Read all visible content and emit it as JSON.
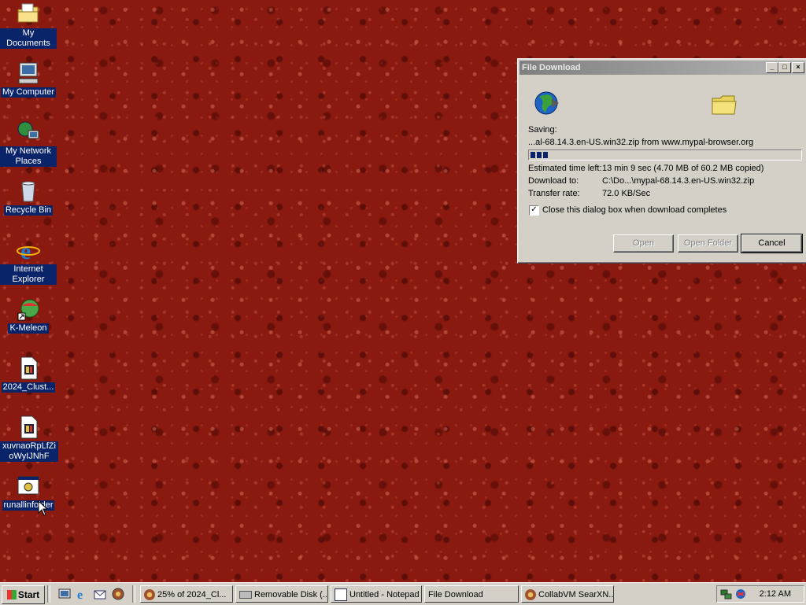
{
  "desktop": {
    "icons": [
      {
        "label": "My Documents",
        "icon": "my-documents-icon"
      },
      {
        "label": "My Computer",
        "icon": "my-computer-icon"
      },
      {
        "label": "My Network Places",
        "icon": "network-places-icon"
      },
      {
        "label": "Recycle Bin",
        "icon": "recycle-bin-icon"
      },
      {
        "label": "Internet Explorer",
        "icon": "internet-explorer-icon"
      },
      {
        "label": "K-Meleon",
        "icon": "k-meleon-icon"
      },
      {
        "label": "2024_Clust...",
        "icon": "file-icon"
      },
      {
        "label": "xuvnaoRpLfZioWyIJNhF",
        "icon": "file-icon"
      },
      {
        "label": "runallinfolder",
        "icon": "program-icon"
      }
    ]
  },
  "dialog": {
    "title": "File Download",
    "saving_label": "Saving:",
    "filename": "...al-68.14.3.en-US.win32.zip from www.mypal-browser.org",
    "progress_fraction": 0.08,
    "time_left_label": "Estimated time left:",
    "time_left_value": "13 min 9 sec (4.70 MB of 60.2 MB copied)",
    "download_to_label": "Download to:",
    "download_to_value": "C:\\Do...\\mypal-68.14.3.en-US.win32.zip",
    "rate_label": "Transfer rate:",
    "rate_value": "72.0 KB/Sec",
    "close_checkbox_label": "Close this dialog box when download completes",
    "close_checkbox_checked": true,
    "buttons": {
      "open": "Open",
      "open_folder": "Open Folder",
      "cancel": "Cancel"
    },
    "title_buttons": {
      "minimize": "_",
      "maximize": "□",
      "close": "×"
    }
  },
  "taskbar": {
    "start_label": "Start",
    "tasks": [
      {
        "label": "25% of 2024_Cl...",
        "icon": "k-meleon-icon"
      },
      {
        "label": "Removable Disk (...",
        "icon": "drive-icon"
      },
      {
        "label": "Untitled - Notepad",
        "icon": "notepad-icon"
      },
      {
        "label": "File Download",
        "icon": ""
      },
      {
        "label": "CollabVM SearXN...",
        "icon": "k-meleon-icon"
      }
    ],
    "clock": "2:12 AM"
  },
  "colors": {
    "selection": "#0a246a",
    "desktop": "#8a1a10",
    "face": "#d4d0c8"
  }
}
